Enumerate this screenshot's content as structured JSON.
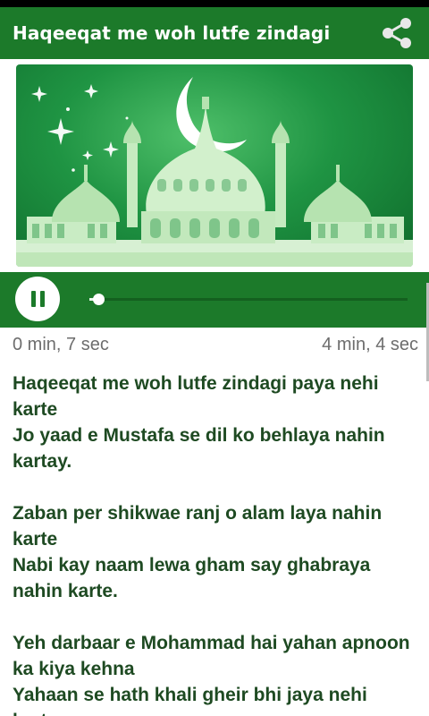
{
  "app": {
    "title": "Haqeeqat me woh lutfe zindagi",
    "share_icon": "share-icon",
    "accent_color": "#1c7a2a"
  },
  "player": {
    "state": "playing",
    "pause_icon": "pause-icon",
    "elapsed": "0 min, 7 sec",
    "duration": "4 min, 4 sec",
    "progress_fraction": 0.029
  },
  "lyrics": {
    "stanzas": [
      [
        "Haqeeqat me woh lutfe zindagi paya nehi karte",
        "Jo yaad e Mustafa se dil ko behlaya nahin kartay."
      ],
      [
        "Zaban per shikwae ranj o alam laya nahin karte",
        "Nabi kay naam lewa gham say ghabraya nahin karte."
      ],
      [
        "Yeh darbaar e Mohammad hai yahan apnoon ka kiya kehna",
        "Yahaan se hath khali gheir bhi jaya nehi karte"
      ]
    ]
  }
}
